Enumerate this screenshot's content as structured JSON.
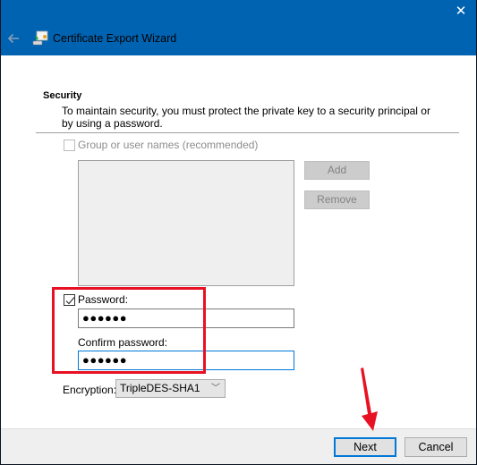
{
  "window": {
    "title": "Certificate Export Wizard",
    "close_icon": "close-icon",
    "back_icon": "back-arrow-icon",
    "app_icon": "certificate-wizard-icon",
    "titlebar_color": "#0063b1"
  },
  "security": {
    "heading": "Security",
    "description": "To maintain security, you must protect the private key to a security principal or by using a password.",
    "group_checkbox": {
      "label": "Group or user names (recommended)",
      "checked": false,
      "enabled": false
    },
    "user_list": {
      "items": []
    },
    "add_button": "Add",
    "remove_button": "Remove",
    "password_checkbox": {
      "label": "Password:",
      "checked": true
    },
    "password_value": "●●●●●●",
    "confirm_label": "Confirm password:",
    "confirm_value": "●●●●●●",
    "encryption_label": "Encryption:",
    "encryption_value": "TripleDES-SHA1"
  },
  "footer": {
    "next_button": "Next",
    "cancel_button": "Cancel"
  },
  "annotations": {
    "highlight_color": "#e81123",
    "arrow_color": "#e81123"
  }
}
